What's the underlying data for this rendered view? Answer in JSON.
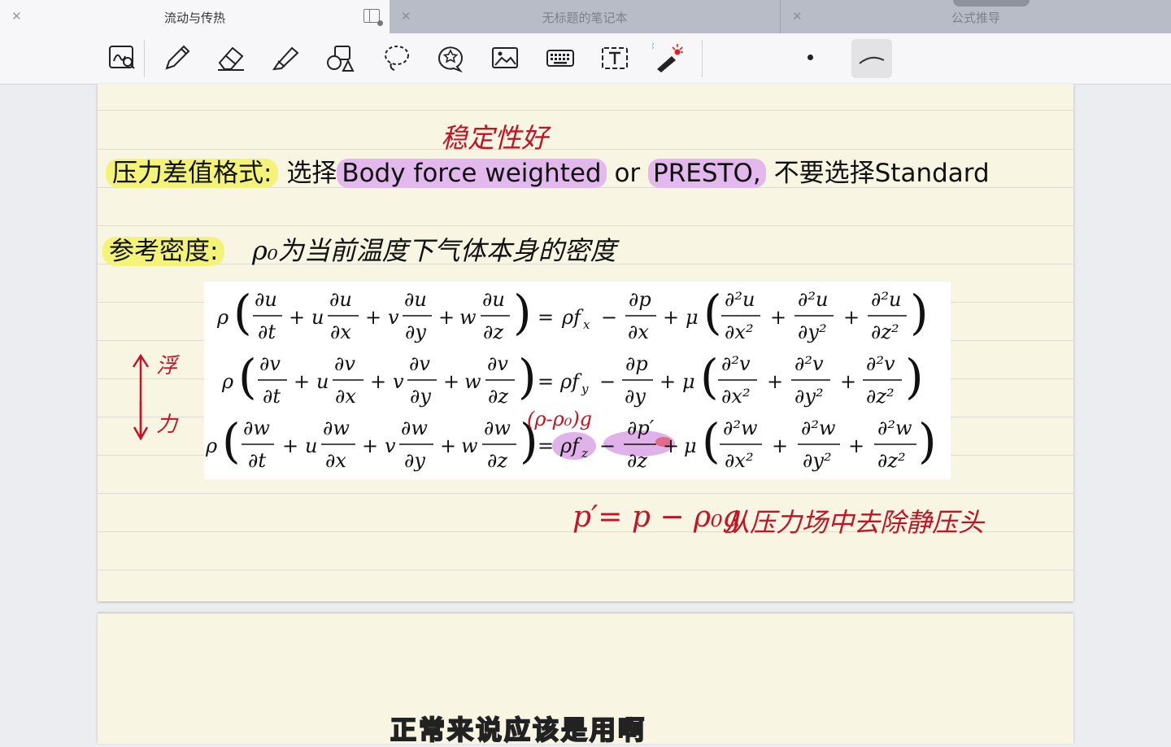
{
  "tabs": [
    {
      "label": "流动与传热",
      "active": true
    },
    {
      "label": "无标题的笔记本",
      "active": false
    },
    {
      "label": "公式推导",
      "active": false
    }
  ],
  "toolbar": {
    "tools": [
      "zoom-write-icon",
      "pen-icon",
      "eraser-icon",
      "highlighter-icon",
      "shapes-icon",
      "lasso-icon",
      "sticker-icon",
      "image-icon",
      "keyboard-icon",
      "textbox-icon",
      "laser-pointer-icon"
    ],
    "selected_stroke": "curve"
  },
  "note": {
    "heading1_label": "压力差值格式:",
    "heading1_pre": "选择",
    "heading1_opt1": "Body force weighted",
    "heading1_or": "or",
    "heading1_opt2": "PRESTO,",
    "heading1_post": "不要选择Standard",
    "annotation_stability": "稳定性好",
    "heading2_label": "参考密度:",
    "heading2_hand": "ρ₀为当前温度下气体本身的密度",
    "arrow_up_label": "浮",
    "arrow_down_label": "力",
    "eq_annotation": "(ρ-ρ₀)g",
    "formula_hand": "p′= p − ρ₀g",
    "formula_hand_note": "从压力场中去除静压头"
  },
  "subtitle": "正常来说应该是用啊",
  "colors": {
    "accent_red": "#c21424",
    "highlight_yellow": "#f3f377",
    "highlight_purple": "#e3b8ec",
    "paper": "#f8f6e3"
  }
}
